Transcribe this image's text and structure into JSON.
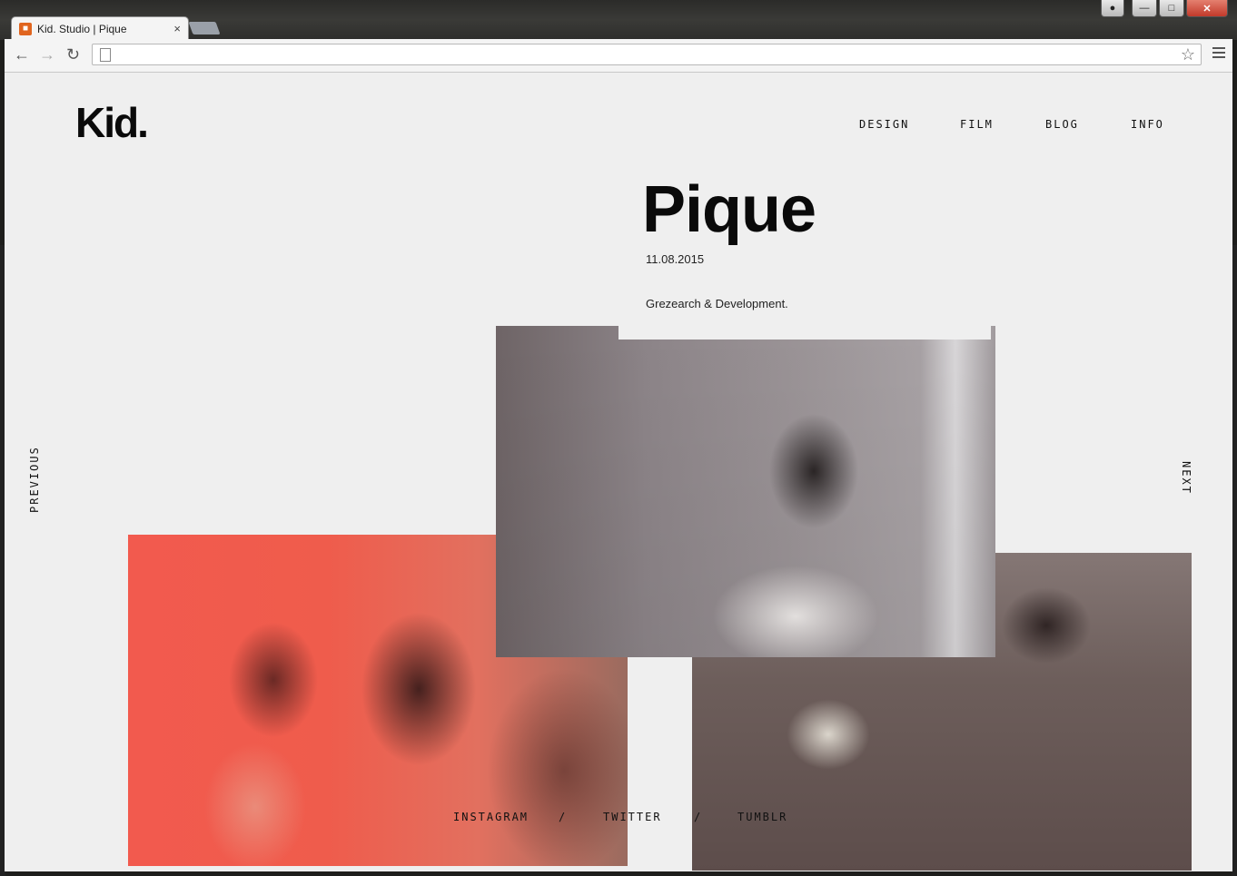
{
  "browser": {
    "tab_title": "Kid. Studio | Pique",
    "tab_close": "×",
    "address": ""
  },
  "site": {
    "logo": "Kid.",
    "nav": [
      "DESIGN",
      "FILM",
      "BLOG",
      "INFO"
    ],
    "project_title": "Pique",
    "date": "11.08.2015",
    "description": "Grezearch & Development.",
    "previous": "PREVIOUS",
    "next": "NEXT",
    "footer": {
      "instagram": "INSTAGRAM",
      "sep1": "/",
      "twitter": "TWITTER",
      "sep2": "/",
      "tumblr": "TUMBLR"
    }
  }
}
